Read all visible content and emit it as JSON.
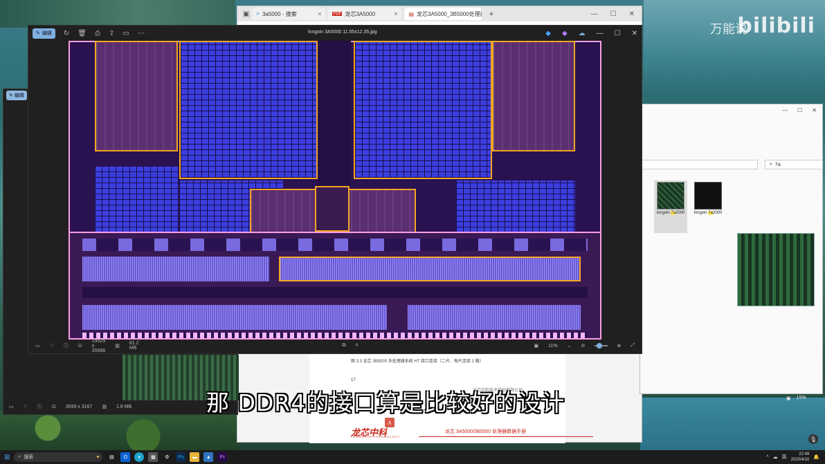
{
  "watermark": {
    "brand": "bilibili",
    "channel": "万能说"
  },
  "browser": {
    "tabs": [
      {
        "label": "3a5000 - 搜索",
        "icon": "search-icon"
      },
      {
        "label": "龙芯3A5000",
        "icon": "pdf-icon"
      },
      {
        "label": "龙芯3A5000_3B5000处理器数据",
        "icon": "document-icon"
      }
    ],
    "new_tab": "+",
    "pdf": {
      "caption": "图 3.3  龙芯 3B5000 多处理器系统 HT 接口连接（二片、每片连接 2 路）",
      "page_number": "17",
      "company": "龙芯中科技术股份有限公司",
      "logo_cn": "龙芯中科",
      "logo_en": "LOONGSON TECHNOLOGY",
      "manual_title": "龙芯 3A5000/3B5000 处理器数据手册"
    }
  },
  "viewer": {
    "edit_label": "编辑",
    "filename": "longxin 3A5000 11.55x12.35.jpg",
    "dimensions": "19525 x 20666",
    "filesize": "61.2 MB",
    "zoom": "11%",
    "zoom_level": 0.05
  },
  "viewer2": {
    "edit_label": "编辑",
    "dimensions": "3599 x 3167",
    "filesize": "1.8 MB"
  },
  "explorer": {
    "search_value": "7a",
    "items": [
      {
        "prefix": "longxin ",
        "match": "7a",
        "suffix": "2000"
      },
      {
        "prefix": "longxin ",
        "match": "7a",
        "suffix": "2000"
      }
    ],
    "zoom": "15%"
  },
  "subtitle": "那 DDR4的接口算是比较好的设计",
  "taskbar": {
    "search_label": "搜索",
    "apps": [
      "Ps",
      "Pr"
    ],
    "ime": "英",
    "time": "22:48",
    "date": "2025/4/10"
  }
}
